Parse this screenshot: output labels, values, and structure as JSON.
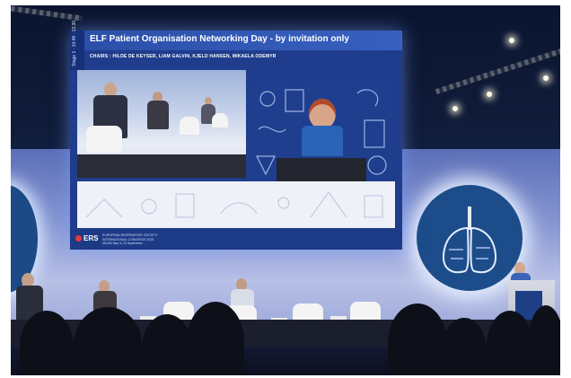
{
  "screen": {
    "side_label": "Stage 1 · 10:48 · 13:30",
    "title": "ELF Patient Organisation Networking Day - by invitation only",
    "chairs": "CHAIRS : HILDE DE KEYSER, LIAM GALVIN, KJELD HANSEN, MIKAELA ODEMYR",
    "footer_logo": "ERS",
    "footer_lines": [
      "EUROPEAN RESPIRATORY SOCIETY",
      "INTERNATIONAL CONGRESS 2023",
      "MILAN Italy 9–13 September"
    ]
  },
  "colors": {
    "screen_blue": "#1f3d8c",
    "backdrop": "#8796d2",
    "ers_red": "#e03b3b"
  }
}
